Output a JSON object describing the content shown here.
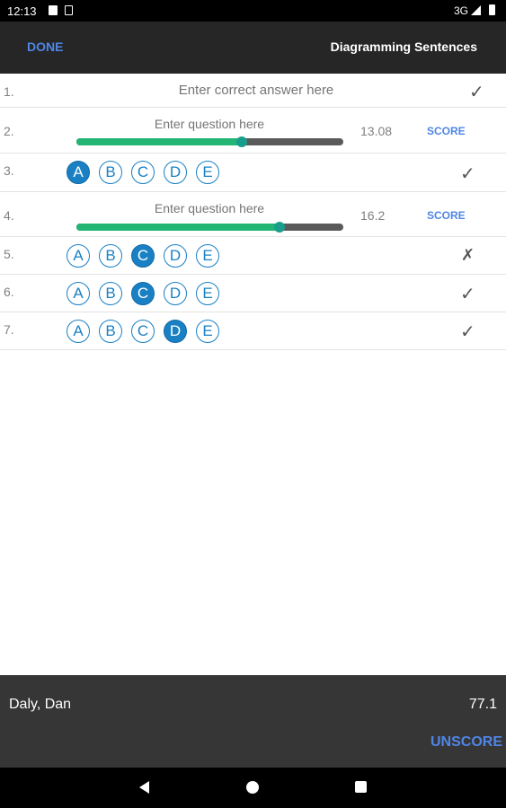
{
  "status_bar": {
    "time": "12:13",
    "network": "3G",
    "icons": [
      "sim-card-icon",
      "sd-card-icon",
      "signal-icon",
      "battery-icon"
    ]
  },
  "toolbar": {
    "done_label": "DONE",
    "title": "Diagramming Sentences"
  },
  "colors": {
    "accent": "#4f86e6",
    "bubble": "#1a80c4",
    "slider_fill": "#22b573",
    "toolbar_bg": "#262626",
    "footer_bg": "#363636"
  },
  "rows": [
    {
      "number": "1.",
      "type": "text-answer",
      "placeholder": "Enter correct answer here",
      "mark": "✓"
    },
    {
      "number": "2.",
      "type": "slider",
      "placeholder": "Enter question here",
      "level_fraction": 0.62,
      "score": "13.08",
      "score_label": "SCORE"
    },
    {
      "number": "3.",
      "type": "choice",
      "options": [
        "A",
        "B",
        "C",
        "D",
        "E"
      ],
      "selected": "A",
      "mark": "✓"
    },
    {
      "number": "4.",
      "type": "slider",
      "placeholder": "Enter question here",
      "level_fraction": 0.76,
      "score": "16.2",
      "score_label": "SCORE"
    },
    {
      "number": "5.",
      "type": "choice",
      "options": [
        "A",
        "B",
        "C",
        "D",
        "E"
      ],
      "selected": "C",
      "mark": "✗"
    },
    {
      "number": "6.",
      "type": "choice",
      "options": [
        "A",
        "B",
        "C",
        "D",
        "E"
      ],
      "selected": "C",
      "mark": "✓"
    },
    {
      "number": "7.",
      "type": "choice",
      "options": [
        "A",
        "B",
        "C",
        "D",
        "E"
      ],
      "selected": "D",
      "mark": "✓"
    }
  ],
  "footer": {
    "student_name": "Daly, Dan",
    "total_score": "77.1",
    "unscore_label": "UNSCORE"
  },
  "nav": {
    "icons": [
      "back-icon",
      "home-icon",
      "recent-apps-icon"
    ]
  }
}
